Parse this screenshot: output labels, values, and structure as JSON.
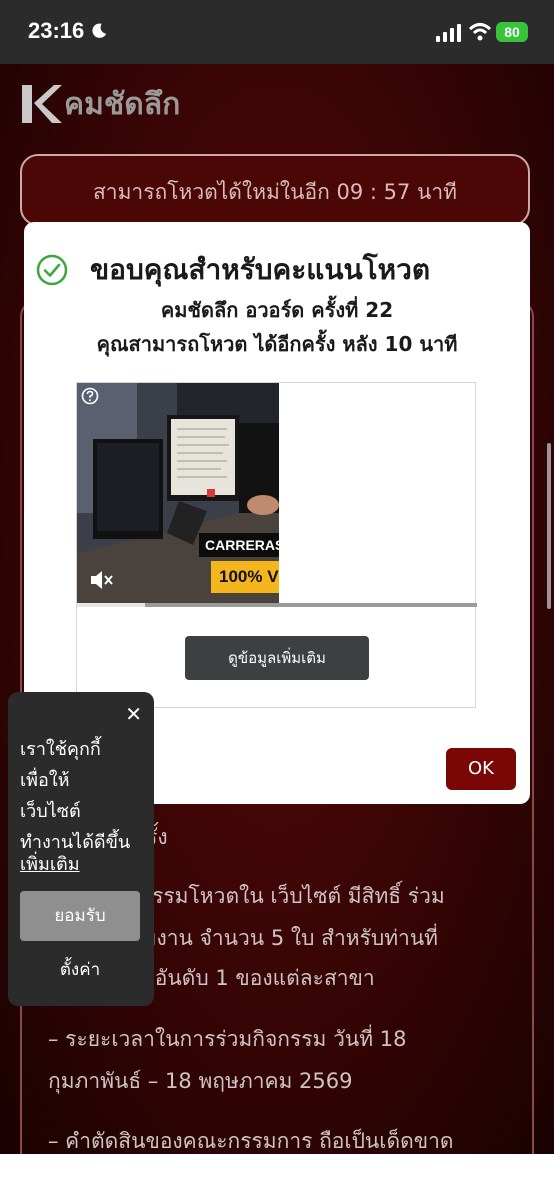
{
  "status_bar": {
    "time": "23:16",
    "battery": "80"
  },
  "brand": {
    "logo_text": "คมชัดลึก"
  },
  "countdown": {
    "text": "สามารถโหวตได้ใหม่ในอีก 09 : 57 นาที"
  },
  "page_content": {
    "lines": [
      "1 ครั้ง",
      "– ผู้ร่วมกิจกรรมโหวตใน เว็บไซต์  มีสิทธิ์ ร่วม",
      "บัตรเข้าร่วมงาน จำนวน 5 ใบ สำหรับท่านที่",
      "โหวตสูงสุด อันดับ 1 ของแต่ละสาขา",
      "– ระยะเวลาในการร่วมกิจกรรม วันที่ 18",
      "กุมภาพันธ์ – 18 พฤษภาคม 2569",
      "– คำตัดสินของคณะกรรมการ ถือเป็นเด็ดขาด"
    ]
  },
  "modal": {
    "title": "ขอบคุณสำหรับคะแนนโหวต",
    "subtitle1": "คมชัดลึก อวอร์ด ครั้งที่ 22",
    "subtitle2": "คุณสามารถโหวต ได้อีกครั้ง หลัง 10 นาที",
    "ok_label": "OK",
    "check_color": "#3aa83a"
  },
  "ad": {
    "caption_line1": "CARRERAS A",
    "caption_line2": "100% V",
    "progress": 0.17,
    "more_info_label": "ดูข้อมูลเพิ่มเติม"
  },
  "cookie": {
    "close_glyph": "✕",
    "text_lines": [
      "เราใช้คุกกี้",
      "เพื่อให้",
      "เว็บไซต์",
      "ทำงานได้ดีขึ้น"
    ],
    "more_link": "เพิ่มเติม",
    "accept_label": "ยอมรับ",
    "settings_label": "ตั้งค่า"
  }
}
